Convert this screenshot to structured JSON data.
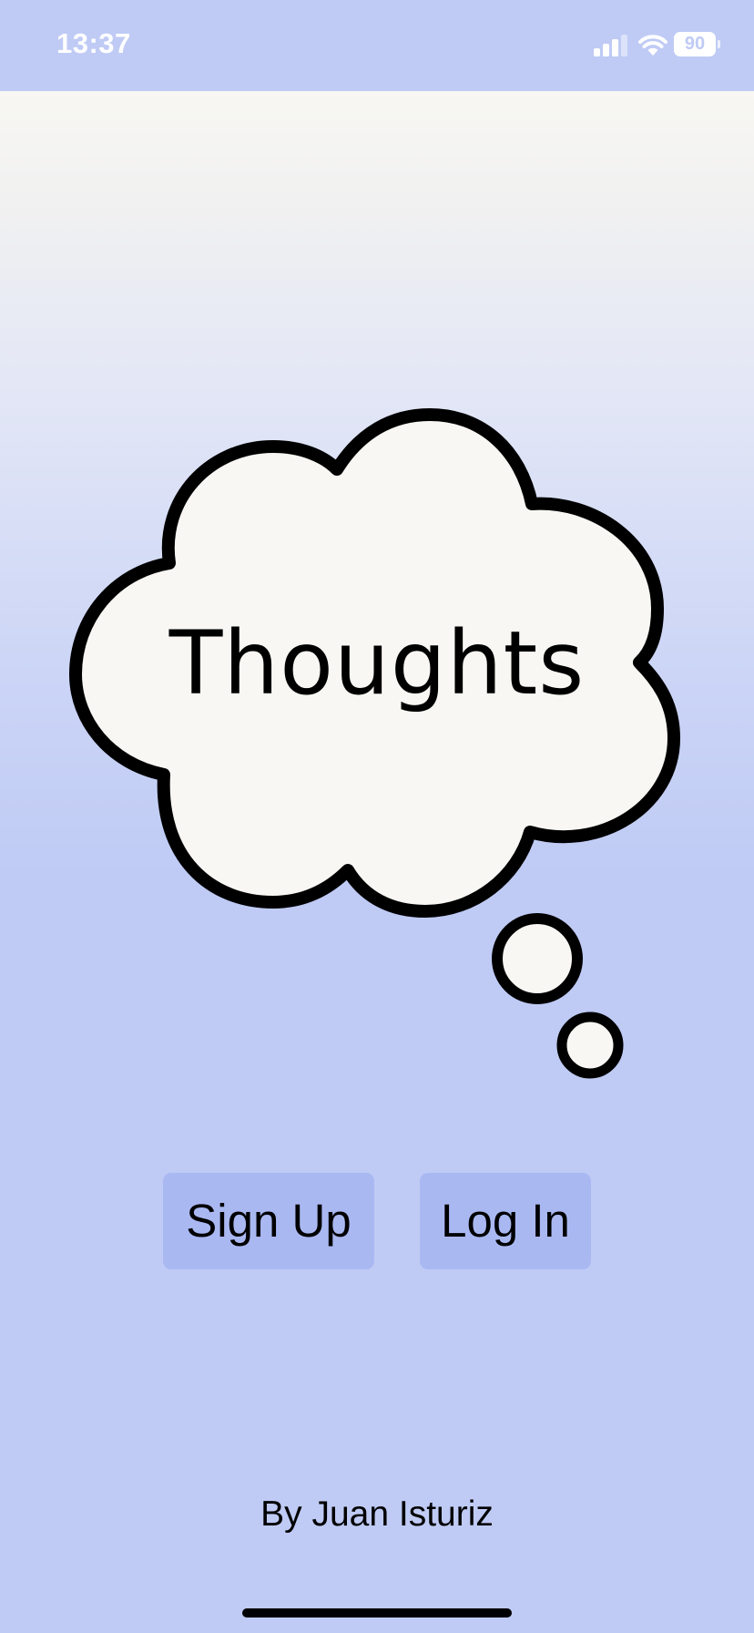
{
  "status_bar": {
    "time": "13:37",
    "battery_level": "90",
    "icons": [
      "signal-icon",
      "wifi-icon",
      "battery-icon"
    ]
  },
  "app": {
    "title": "Thoughts"
  },
  "buttons": {
    "sign_up": "Sign Up",
    "log_in": "Log In"
  },
  "footer": {
    "credit": "By Juan Isturiz"
  },
  "colors": {
    "background": "#bfcbf5",
    "background_top": "#f8f7f3",
    "cloud_fill": "#f8f7f3",
    "cloud_stroke": "#000000",
    "button_bg": "#aab8f2",
    "text": "#000000"
  }
}
